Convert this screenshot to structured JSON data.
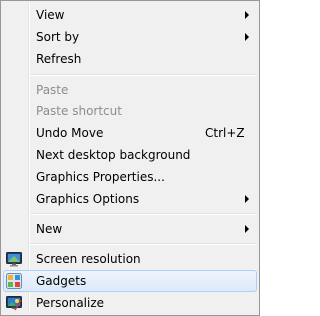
{
  "menu": {
    "items": [
      {
        "label": "View",
        "submenu": true,
        "disabled": false
      },
      {
        "label": "Sort by",
        "submenu": true,
        "disabled": false
      },
      {
        "label": "Refresh",
        "submenu": false,
        "disabled": false
      },
      {
        "label": "Paste",
        "submenu": false,
        "disabled": true
      },
      {
        "label": "Paste shortcut",
        "submenu": false,
        "disabled": true
      },
      {
        "label": "Undo Move",
        "shortcut": "Ctrl+Z",
        "submenu": false,
        "disabled": false
      },
      {
        "label": "Next desktop background",
        "submenu": false,
        "disabled": false
      },
      {
        "label": "Graphics Properties...",
        "submenu": false,
        "disabled": false
      },
      {
        "label": "Graphics Options",
        "submenu": true,
        "disabled": false
      },
      {
        "label": "New",
        "submenu": true,
        "disabled": false
      },
      {
        "label": "Screen resolution",
        "icon": "monitor-icon",
        "submenu": false,
        "disabled": false
      },
      {
        "label": "Gadgets",
        "icon": "gadgets-icon",
        "submenu": false,
        "disabled": false,
        "highlighted": true
      },
      {
        "label": "Personalize",
        "icon": "personalize-icon",
        "submenu": false,
        "disabled": false
      }
    ]
  },
  "colors": {
    "menu_background": "#f0f0f0",
    "border": "#979797",
    "disabled_text": "#8d8d8d",
    "highlight_border": "#aecff7",
    "highlight_fill": "#dce9f9"
  }
}
